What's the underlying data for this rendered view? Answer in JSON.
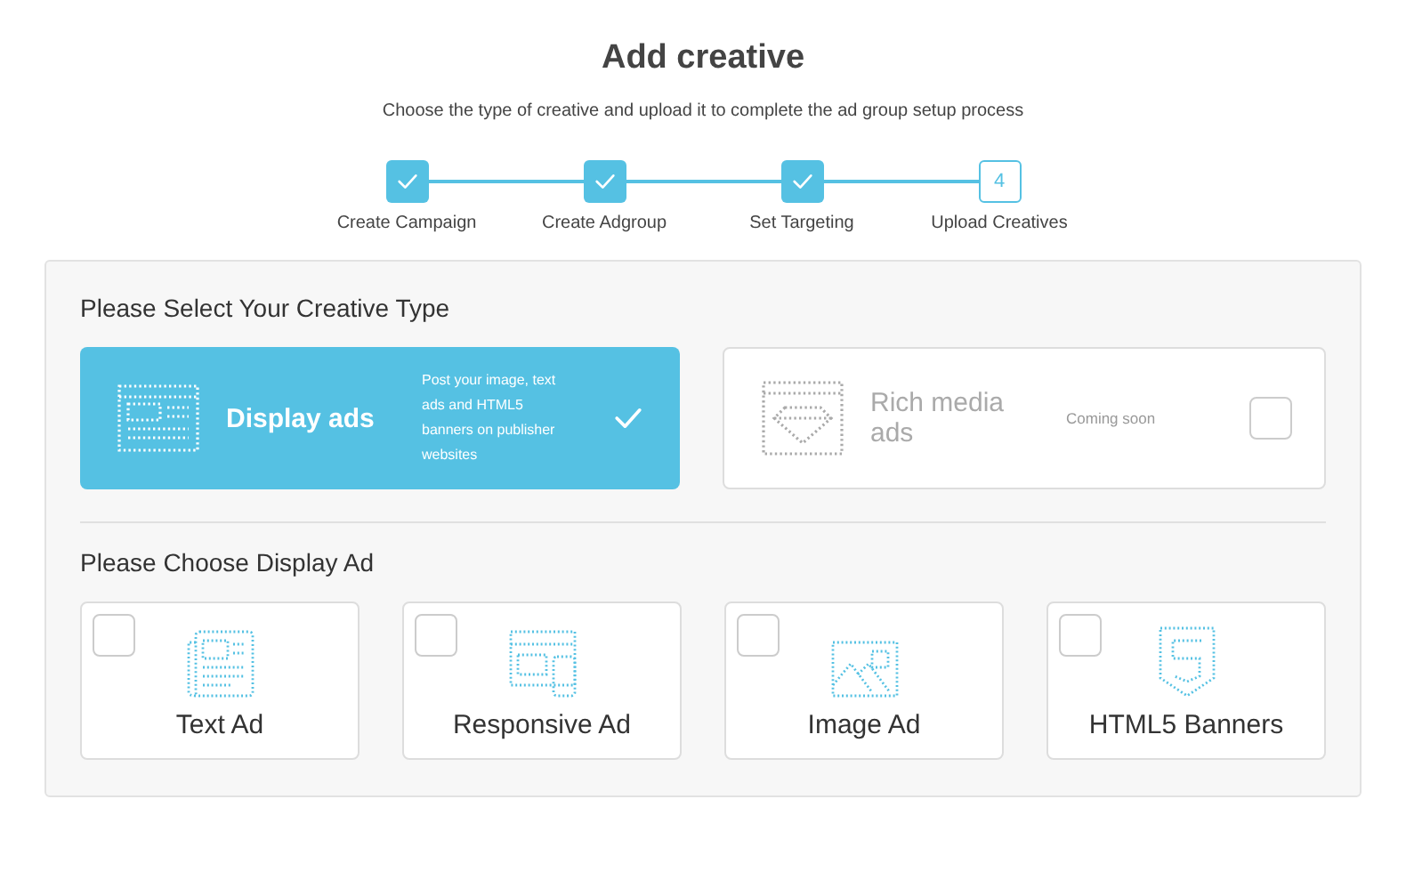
{
  "header": {
    "title": "Add creative",
    "subtitle": "Choose the type of creative and upload it to complete the ad group setup process"
  },
  "steps": [
    {
      "label": "Create Campaign",
      "done": true
    },
    {
      "label": "Create Adgroup",
      "done": true
    },
    {
      "label": "Set Targeting",
      "done": true
    },
    {
      "label": "Upload Creatives",
      "done": false,
      "number": "4"
    }
  ],
  "creative_type": {
    "heading": "Please Select Your Creative Type",
    "options": [
      {
        "kind": "display",
        "title": "Display ads",
        "description": "Post your image, text ads and HTML5 banners on publisher websites",
        "selected": true,
        "disabled": false
      },
      {
        "kind": "rich",
        "title": "Rich media ads",
        "note": "Coming soon",
        "selected": false,
        "disabled": true
      }
    ]
  },
  "display_ad": {
    "heading": "Please Choose Display Ad",
    "options": [
      {
        "kind": "text",
        "label": "Text Ad",
        "checked": false
      },
      {
        "kind": "responsive",
        "label": "Responsive Ad",
        "checked": false
      },
      {
        "kind": "image",
        "label": "Image Ad",
        "checked": false
      },
      {
        "kind": "html5",
        "label": "HTML5 Banners",
        "checked": false
      }
    ]
  }
}
